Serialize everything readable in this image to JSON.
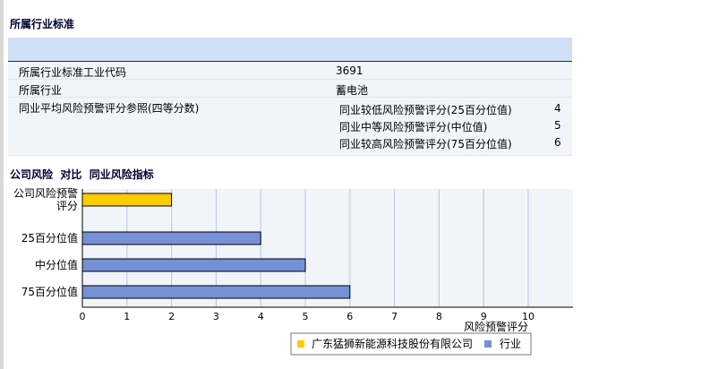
{
  "section1_title": "所属行业标准",
  "info": {
    "code_label": "所属行业标准工业代码",
    "code_value": "3691",
    "industry_label": "所属行业",
    "industry_value": "蓄电池",
    "avg_label": "同业平均风险预警评分参照(四等分数)",
    "avg_items": [
      {
        "label": "同业较低风险预警评分(25百分位值)",
        "value": "4"
      },
      {
        "label": "同业中等风险预警评分(中位值)",
        "value": "5"
      },
      {
        "label": "同业较高风险预警评分(75百分位值)",
        "value": "6"
      }
    ]
  },
  "section2_title": "公司风险  对比  同业风险指标",
  "chart_data": {
    "type": "bar",
    "orientation": "horizontal",
    "categories": [
      "公司风险预警评分",
      "25百分位值",
      "中分位值",
      "75百分位值"
    ],
    "category_lines": [
      [
        "公司风险预警",
        "评分"
      ],
      [
        "25百分位值"
      ],
      [
        "中分位值"
      ],
      [
        "75百分位值"
      ]
    ],
    "values": [
      2,
      4,
      5,
      6
    ],
    "bar_colors": [
      "#ffcc00",
      "#7590d6",
      "#7590d6",
      "#7590d6"
    ],
    "xlim": [
      0,
      10
    ],
    "xticks": [
      "0",
      "1",
      "2",
      "3",
      "4",
      "5",
      "6",
      "7",
      "8",
      "9",
      "10"
    ],
    "xlabel": "风险预警评分",
    "grid": true,
    "legend": [
      {
        "name": "广东猛狮新能源科技股份有限公司",
        "color": "#ffcc00"
      },
      {
        "name": "行业",
        "color": "#7590d6"
      }
    ],
    "legend_position": "bottom"
  }
}
